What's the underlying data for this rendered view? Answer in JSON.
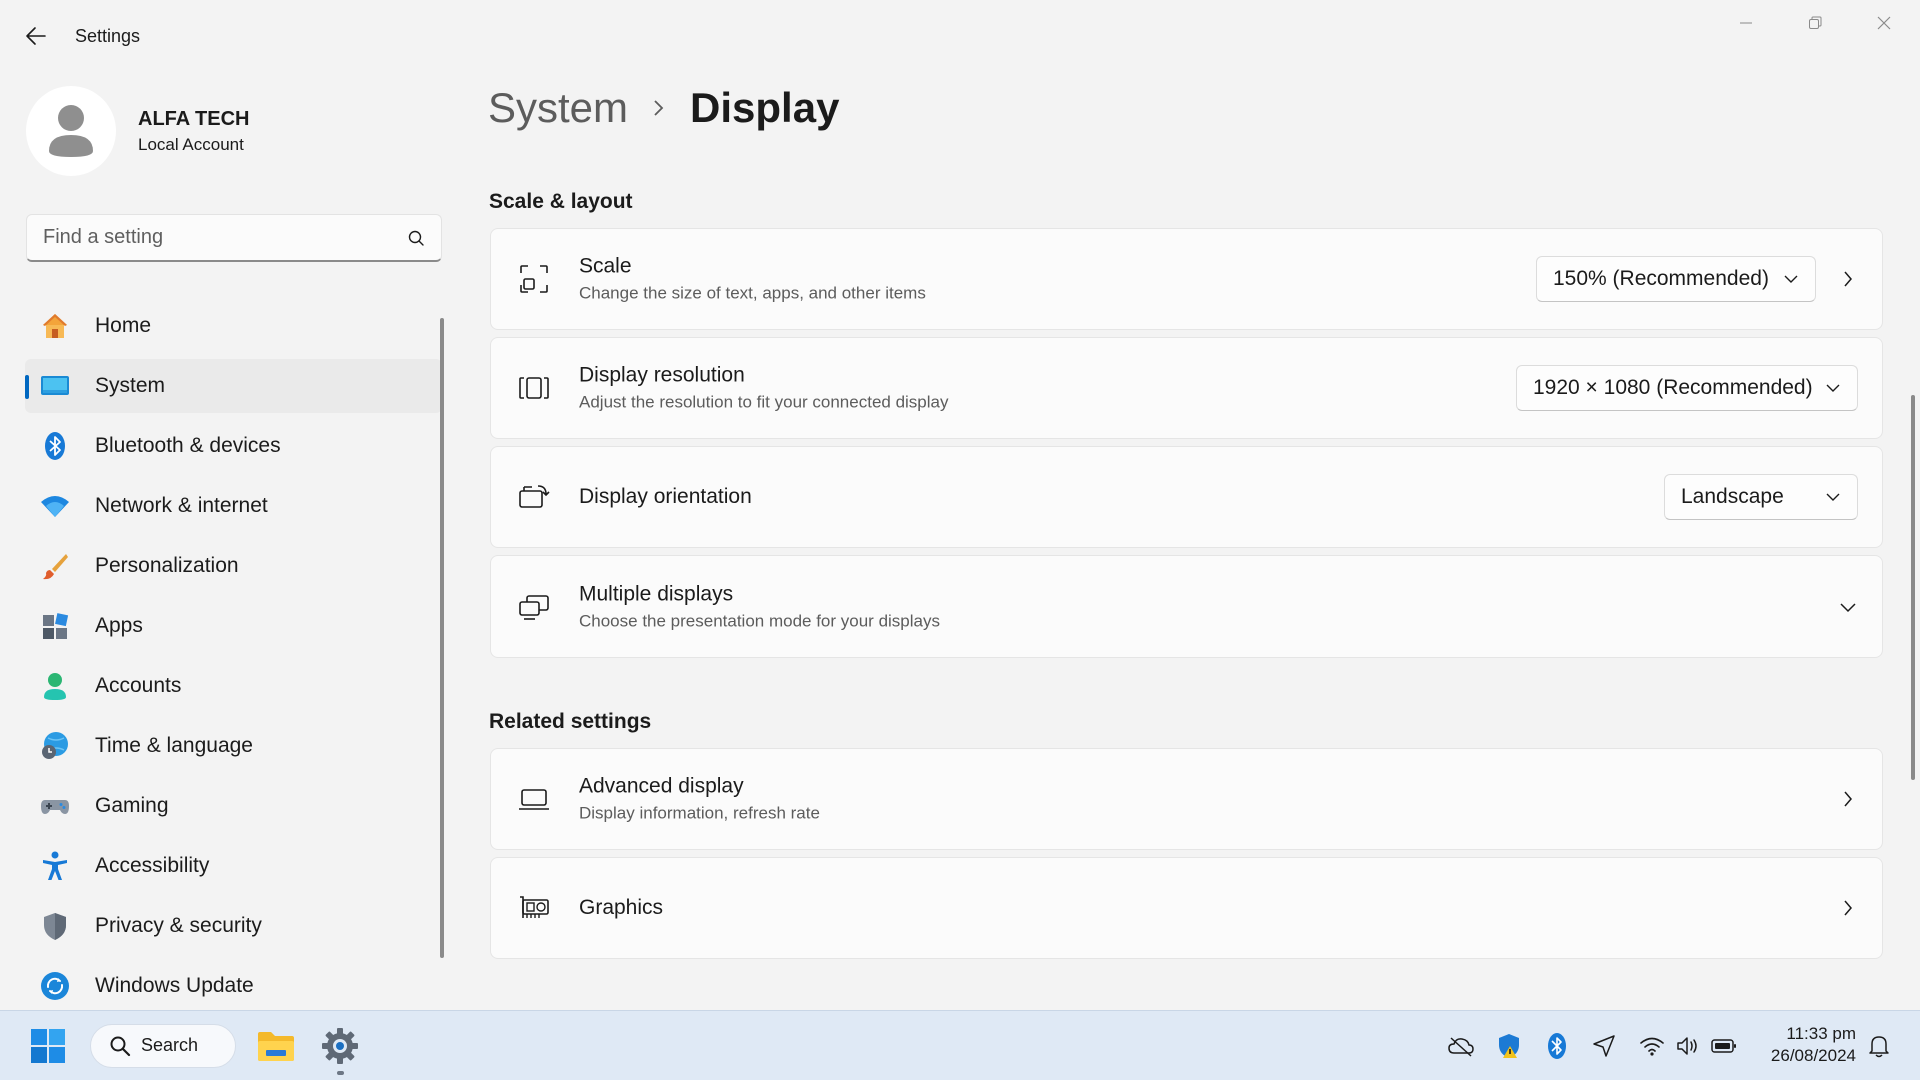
{
  "window": {
    "title": "Settings",
    "back_label": "Back"
  },
  "profile": {
    "name": "ALFA TECH",
    "account_type": "Local Account"
  },
  "search": {
    "placeholder": "Find a setting",
    "value": ""
  },
  "sidebar": {
    "items": [
      {
        "label": "Home",
        "icon": "home-icon"
      },
      {
        "label": "System",
        "icon": "system-icon",
        "active": true
      },
      {
        "label": "Bluetooth & devices",
        "icon": "bluetooth-icon"
      },
      {
        "label": "Network & internet",
        "icon": "wifi-icon"
      },
      {
        "label": "Personalization",
        "icon": "brush-icon"
      },
      {
        "label": "Apps",
        "icon": "apps-icon"
      },
      {
        "label": "Accounts",
        "icon": "accounts-icon"
      },
      {
        "label": "Time & language",
        "icon": "globe-clock-icon"
      },
      {
        "label": "Gaming",
        "icon": "gamepad-icon"
      },
      {
        "label": "Accessibility",
        "icon": "accessibility-icon"
      },
      {
        "label": "Privacy & security",
        "icon": "shield-icon"
      },
      {
        "label": "Windows Update",
        "icon": "update-icon"
      }
    ]
  },
  "breadcrumb": {
    "parent": "System",
    "current": "Display"
  },
  "sections": {
    "scale_layout": {
      "title": "Scale & layout",
      "scale": {
        "title": "Scale",
        "subtitle": "Change the size of text, apps, and other items",
        "value": "150% (Recommended)"
      },
      "resolution": {
        "title": "Display resolution",
        "subtitle": "Adjust the resolution to fit your connected display",
        "value": "1920 × 1080 (Recommended)"
      },
      "orientation": {
        "title": "Display orientation",
        "value": "Landscape"
      },
      "multiple": {
        "title": "Multiple displays",
        "subtitle": "Choose the presentation mode for your displays"
      }
    },
    "related": {
      "title": "Related settings",
      "advanced": {
        "title": "Advanced display",
        "subtitle": "Display information, refresh rate"
      },
      "graphics": {
        "title": "Graphics"
      }
    }
  },
  "taskbar": {
    "search_label": "Search",
    "time": "11:33 pm",
    "date": "26/08/2024"
  },
  "colors": {
    "accent": "#0067c0",
    "taskbar": "#dfe9f5"
  }
}
